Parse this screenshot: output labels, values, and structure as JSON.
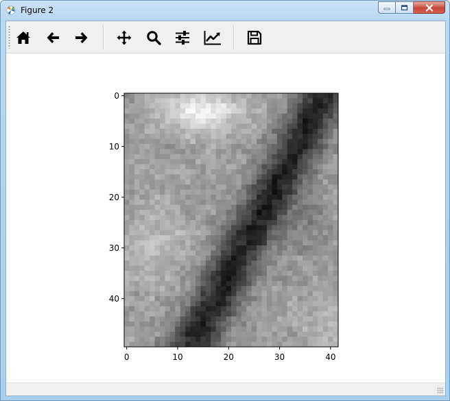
{
  "window": {
    "title": "Figure 2",
    "icon": "matplotlib-icon",
    "controls": [
      "minimize-icon",
      "maximize-icon",
      "close-icon"
    ]
  },
  "toolbar": {
    "buttons": [
      {
        "name": "home",
        "icon": "home-icon",
        "tooltip": "Reset original view"
      },
      {
        "name": "back",
        "icon": "arrow-left-icon",
        "tooltip": "Back to previous view"
      },
      {
        "name": "forward",
        "icon": "arrow-right-icon",
        "tooltip": "Forward to next view"
      },
      {
        "name": "pan",
        "icon": "move-icon",
        "tooltip": "Pan axes"
      },
      {
        "name": "zoom",
        "icon": "magnifier-icon",
        "tooltip": "Zoom to rectangle"
      },
      {
        "name": "subplots",
        "icon": "sliders-icon",
        "tooltip": "Configure subplots"
      },
      {
        "name": "customize",
        "icon": "chart-line-icon",
        "tooltip": "Edit axis"
      },
      {
        "name": "save",
        "icon": "floppy-disk-icon",
        "tooltip": "Save the figure"
      }
    ]
  },
  "status": {
    "text": ""
  },
  "colors": {
    "accent": "#000000",
    "titlebar": "#b9d9f2",
    "toolbar_bg": "#f0f0f0"
  },
  "chart_data": {
    "type": "heatmap",
    "colormap": "gray",
    "shape": [
      50,
      42
    ],
    "xticks": [
      0,
      10,
      20,
      30,
      40
    ],
    "yticks": [
      0,
      10,
      20,
      30,
      40
    ],
    "xlim": [
      -0.5,
      41.5
    ],
    "ylim": [
      49.5,
      -0.5
    ],
    "description_values": "grayscale image with a dark diagonal band from lower-left (x≈15,y≈45) to upper-right (x≈36,y≈5); bright region near top-left/center (x≈15,y≈3)"
  }
}
